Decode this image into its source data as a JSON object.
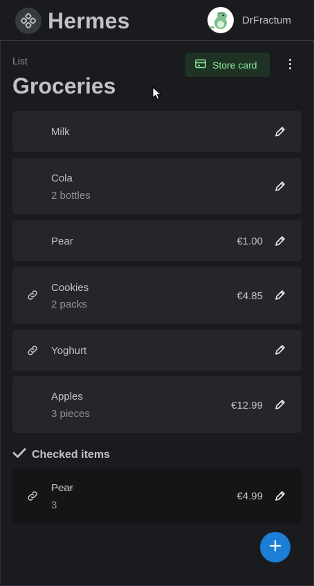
{
  "header": {
    "app_title": "Hermes",
    "username": "DrFractum"
  },
  "list": {
    "label": "List",
    "title": "Groceries",
    "store_card_label": "Store card"
  },
  "items": [
    {
      "name": "Milk",
      "detail": "",
      "price": "",
      "linked": false
    },
    {
      "name": "Cola",
      "detail": "2 bottles",
      "price": "",
      "linked": false
    },
    {
      "name": "Pear",
      "detail": "",
      "price": "€1.00",
      "linked": false
    },
    {
      "name": "Cookies",
      "detail": "2 packs",
      "price": "€4.85",
      "linked": true
    },
    {
      "name": "Yoghurt",
      "detail": "",
      "price": "",
      "linked": true
    },
    {
      "name": "Apples",
      "detail": "3 pieces",
      "price": "€12.99",
      "linked": false
    }
  ],
  "checked_section": {
    "heading": "Checked items",
    "items": [
      {
        "name": "Pear",
        "detail": "3",
        "price": "€4.99",
        "linked": true
      }
    ]
  },
  "colors": {
    "background": "#1a1b1e",
    "card": "#25262b",
    "checked_card": "#141517",
    "accent_blue": "#1c7ed6",
    "store_green": "#8ce99a"
  },
  "icons": {
    "logo": "apps-icon",
    "store": "credit-card-icon",
    "menu": "dots-vertical-icon",
    "edit": "pencil-icon",
    "link": "link-icon",
    "check": "check-icon",
    "add": "plus-icon"
  }
}
